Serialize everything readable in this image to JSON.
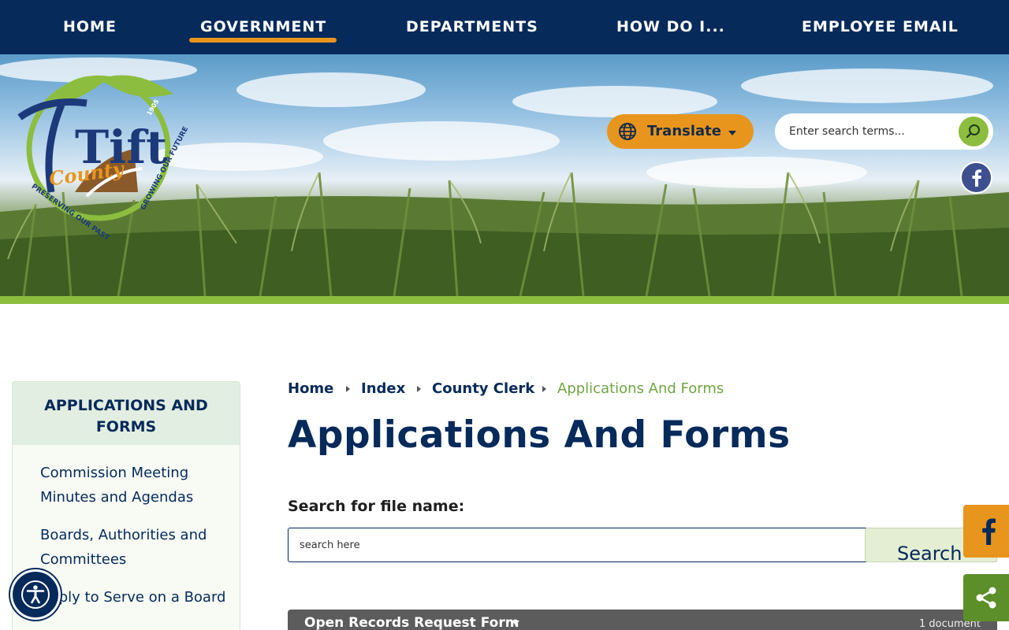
{
  "nav": {
    "items": [
      {
        "label": "HOME",
        "active": false
      },
      {
        "label": "GOVERNMENT",
        "active": true
      },
      {
        "label": "DEPARTMENTS",
        "active": false
      },
      {
        "label": "HOW DO I...",
        "active": false
      },
      {
        "label": "EMPLOYEE EMAIL",
        "active": false
      }
    ],
    "active_color": "#e8951d"
  },
  "logo": {
    "wordmark": "Tift",
    "script": "County",
    "year": "1905",
    "motto_left": "PRESERVING OUR PAST",
    "motto_right": "GROWING OUR FUTURE"
  },
  "header": {
    "translate_label": "Translate",
    "search_placeholder": "Enter search terms...",
    "search_icon": "search-icon",
    "social_icon": "facebook-icon"
  },
  "sidebar": {
    "title": "APPLICATIONS AND FORMS",
    "items": [
      {
        "label": "Commission Meeting Minutes and Agendas"
      },
      {
        "label": "Boards, Authorities and Committees"
      },
      {
        "label": "Apply to Serve on a Board"
      }
    ]
  },
  "breadcrumb": {
    "items": [
      "Home",
      "Index",
      "County Clerk"
    ],
    "current": "Applications And Forms"
  },
  "main": {
    "title": "Applications And Forms",
    "file_search_label": "Search for file name:",
    "file_search_placeholder": "search here",
    "file_search_button": "Search",
    "doc_group": {
      "title": "Open Records Request Form",
      "count": "1 document"
    }
  },
  "colors": {
    "navy": "#062a5a",
    "orange": "#e8951d",
    "green": "#8dbd3f",
    "breadcrumb_current": "#6fa642"
  }
}
